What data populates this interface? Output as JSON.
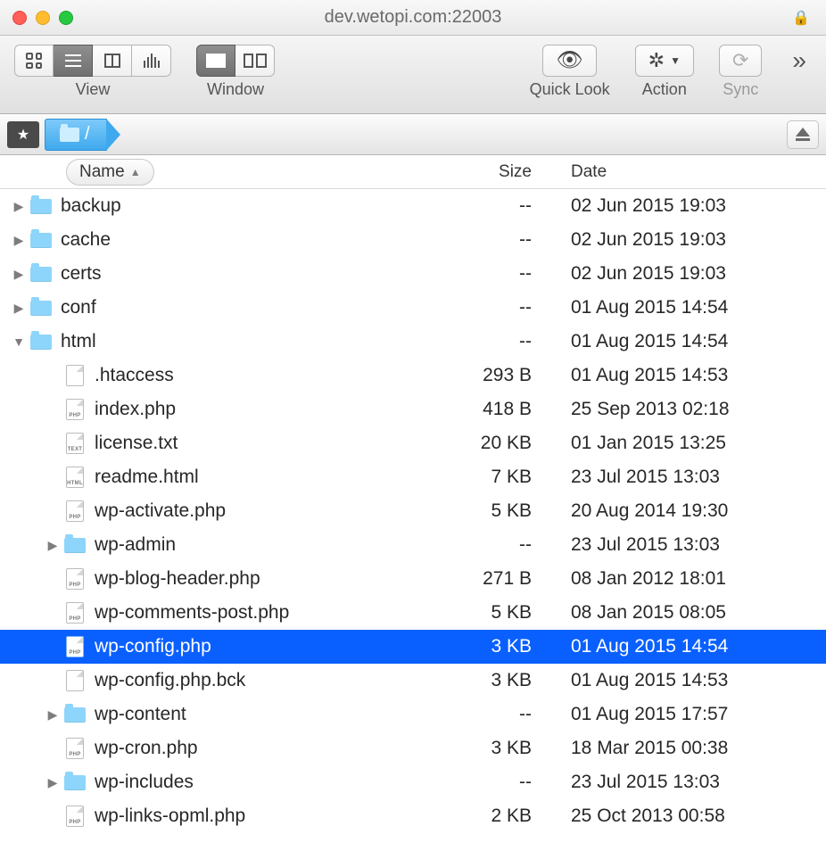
{
  "window": {
    "title": "dev.wetopi.com:22003"
  },
  "toolbar": {
    "view_label": "View",
    "window_label": "Window",
    "quicklook_label": "Quick Look",
    "action_label": "Action",
    "sync_label": "Sync"
  },
  "path": {
    "current": "/"
  },
  "columns": {
    "name": "Name",
    "size": "Size",
    "date": "Date",
    "sort_asc": true
  },
  "rows": [
    {
      "type": "folder",
      "depth": 0,
      "expanded": false,
      "name": "backup",
      "size": "--",
      "date": "02 Jun 2015 19:03"
    },
    {
      "type": "folder",
      "depth": 0,
      "expanded": false,
      "name": "cache",
      "size": "--",
      "date": "02 Jun 2015 19:03"
    },
    {
      "type": "folder",
      "depth": 0,
      "expanded": false,
      "name": "certs",
      "size": "--",
      "date": "02 Jun 2015 19:03"
    },
    {
      "type": "folder",
      "depth": 0,
      "expanded": false,
      "name": "conf",
      "size": "--",
      "date": "01 Aug 2015 14:54"
    },
    {
      "type": "folder",
      "depth": 0,
      "expanded": true,
      "name": "html",
      "size": "--",
      "date": "01 Aug 2015 14:54"
    },
    {
      "type": "file",
      "depth": 1,
      "ext": "",
      "name": ".htaccess",
      "size": "293 B",
      "date": "01 Aug 2015 14:53"
    },
    {
      "type": "file",
      "depth": 1,
      "ext": "PHP",
      "name": "index.php",
      "size": "418 B",
      "date": "25 Sep 2013 02:18"
    },
    {
      "type": "file",
      "depth": 1,
      "ext": "TEXT",
      "name": "license.txt",
      "size": "20 KB",
      "date": "01 Jan 2015 13:25"
    },
    {
      "type": "file",
      "depth": 1,
      "ext": "HTML",
      "name": "readme.html",
      "size": "7 KB",
      "date": "23 Jul 2015 13:03"
    },
    {
      "type": "file",
      "depth": 1,
      "ext": "PHP",
      "name": "wp-activate.php",
      "size": "5 KB",
      "date": "20 Aug 2014 19:30"
    },
    {
      "type": "folder",
      "depth": 1,
      "expanded": false,
      "name": "wp-admin",
      "size": "--",
      "date": "23 Jul 2015 13:03"
    },
    {
      "type": "file",
      "depth": 1,
      "ext": "PHP",
      "name": "wp-blog-header.php",
      "size": "271 B",
      "date": "08 Jan 2012 18:01"
    },
    {
      "type": "file",
      "depth": 1,
      "ext": "PHP",
      "name": "wp-comments-post.php",
      "size": "5 KB",
      "date": "08 Jan 2015 08:05"
    },
    {
      "type": "file",
      "depth": 1,
      "ext": "PHP",
      "name": "wp-config.php",
      "size": "3 KB",
      "date": "01 Aug 2015 14:54",
      "selected": true
    },
    {
      "type": "file",
      "depth": 1,
      "ext": "",
      "name": "wp-config.php.bck",
      "size": "3 KB",
      "date": "01 Aug 2015 14:53"
    },
    {
      "type": "folder",
      "depth": 1,
      "expanded": false,
      "name": "wp-content",
      "size": "--",
      "date": "01 Aug 2015 17:57"
    },
    {
      "type": "file",
      "depth": 1,
      "ext": "PHP",
      "name": "wp-cron.php",
      "size": "3 KB",
      "date": "18 Mar 2015 00:38"
    },
    {
      "type": "folder",
      "depth": 1,
      "expanded": false,
      "name": "wp-includes",
      "size": "--",
      "date": "23 Jul 2015 13:03"
    },
    {
      "type": "file",
      "depth": 1,
      "ext": "PHP",
      "name": "wp-links-opml.php",
      "size": "2 KB",
      "date": "25 Oct 2013 00:58"
    }
  ]
}
